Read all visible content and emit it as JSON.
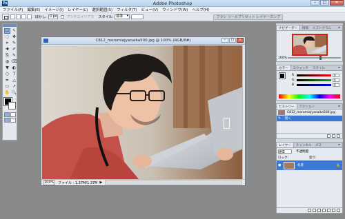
{
  "window": {
    "title": "Adobe Photoshop",
    "minimize": "–",
    "maximize": "□",
    "close": "✕"
  },
  "menu": [
    "ファイル(F)",
    "編集(E)",
    "イメージ(I)",
    "レイヤー(L)",
    "選択範囲(S)",
    "フィルタ(T)",
    "ビュー(V)",
    "ウィンドウ(W)",
    "ヘルプ(H)"
  ],
  "options": {
    "feather_label": "ぼかし:",
    "feather_value": "0 px",
    "antialias_label": "アンチエイリアス",
    "style_label": "スタイル:",
    "style_value": "標準",
    "palette_tabs": "ブラシ  ツールプリセット  レイヤーカンプ"
  },
  "tools": [
    "▭",
    "↖",
    "◌",
    "✥",
    "⌗",
    "✎",
    "✚",
    "✐",
    "⎘",
    "✎",
    "◍",
    "⌫",
    "▼",
    "◐",
    "○",
    "△",
    "✒",
    "T",
    "↗",
    "▭",
    "✎",
    "✋",
    "✋",
    "🔍"
  ],
  "document": {
    "title": "C812_moromiejyanaika500.jpg @ 100% (RGB/8#)",
    "zoom": "100%",
    "file_info": "ファイル : 1.37M/1.37M",
    "status_arrow": "▶",
    "min": "–",
    "max": "□",
    "close": "✕"
  },
  "panels": {
    "navigator": {
      "tabs": [
        "ナビゲーター",
        "情報",
        "ヒストグラム"
      ],
      "zoom": "100%",
      "menu": "▸"
    },
    "color": {
      "tabs": [
        "カラー",
        "スウォッチ",
        "スタイル"
      ],
      "channels": [
        "R",
        "G",
        "B"
      ],
      "values": [
        "0",
        "0",
        "0"
      ],
      "menu": "▸"
    },
    "history": {
      "tabs": [
        "ヒストリー",
        "アクション"
      ],
      "items": [
        "C812_moromiejyanaika500.jpg",
        "開く"
      ],
      "menu": "▸"
    },
    "layers": {
      "tabs": [
        "レイヤー",
        "チャンネル",
        "パス"
      ],
      "mode": "通常",
      "opacity_label": "不透明度:",
      "lock_label": "ロック:",
      "fill_label": "塗り:",
      "layer_name": "背景",
      "lock_icon": "🔒",
      "menu": "▸"
    }
  },
  "colors": {
    "accent": "#3a78d4",
    "nav_frame": "#d0201c",
    "workspace": "#8a8a8a"
  }
}
